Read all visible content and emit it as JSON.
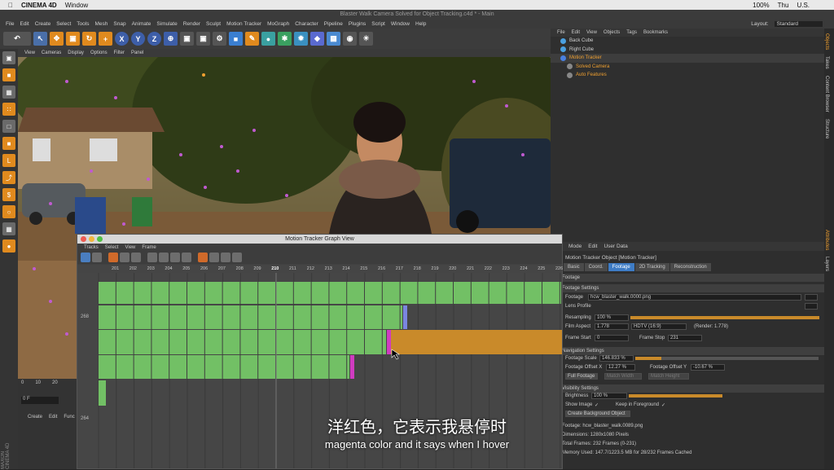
{
  "mac_menubar": {
    "app": "CINEMA 4D",
    "window": "Window",
    "status_right": "100%",
    "day": "Thu",
    "lang": "U.S."
  },
  "window_title": "Blaster Walk Camera Solved for Object Tracking.c4d * - Main",
  "main_menu": [
    "File",
    "Edit",
    "Create",
    "Select",
    "Tools",
    "Mesh",
    "Snap",
    "Animate",
    "Simulate",
    "Render",
    "Sculpt",
    "Motion Tracker",
    "MoGraph",
    "Character",
    "Pipeline",
    "Plugins",
    "Script",
    "Window",
    "Help"
  ],
  "layout": {
    "label": "Layout:",
    "value": "Standard"
  },
  "viewport_menu": [
    "View",
    "Cameras",
    "Display",
    "Options",
    "Filter",
    "Panel"
  ],
  "viewport_label": "Perspective",
  "object_manager": {
    "menu": [
      "File",
      "Edit",
      "View",
      "Objects",
      "Tags",
      "Bookmarks"
    ],
    "objects": [
      {
        "name": "Back Cube",
        "color": "#cfcfcf"
      },
      {
        "name": "Right Cube",
        "color": "#cfcfcf"
      },
      {
        "name": "Motion Tracker",
        "color": "#f0a030"
      },
      {
        "name": "Solved Camera",
        "color": "#f0a030"
      },
      {
        "name": "Auto Features",
        "color": "#f0a030"
      }
    ]
  },
  "right_tabs": [
    "Objects",
    "Takes",
    "Content Browser",
    "Structure"
  ],
  "right_tabs_bottom": [
    "Attributes",
    "Layers"
  ],
  "attributes": {
    "menu": [
      "Mode",
      "Edit",
      "User Data"
    ],
    "object_title": "Motion Tracker Object [Motion Tracker]",
    "tabs": [
      "Basic",
      "Coord.",
      "Footage",
      "2D Tracking",
      "Reconstruction"
    ],
    "active_tab": "Footage",
    "section_footage": "Footage",
    "sub_footage_settings": "Footage Settings",
    "footage_label": "Footage",
    "footage_value": "hcw_blaster_walk.0000.png",
    "lens_profile_label": "Lens Profile",
    "resampling_label": "Resampling",
    "resampling_value": "100 %",
    "film_aspect_label": "Film Aspect",
    "film_aspect_value": "1.778",
    "film_aspect_preset": "HDTV (16:9)",
    "render_aspect": "(Render: 1.778)",
    "frame_start_label": "Frame Start",
    "frame_start_value": "0",
    "frame_stop_label": "Frame Stop",
    "frame_stop_value": "231",
    "nav_settings": "Navigation Settings",
    "footage_scale_label": "Footage Scale",
    "footage_scale_value": "146.833 %",
    "offset_x_label": "Footage Offset X",
    "offset_x_value": "12.27 %",
    "offset_y_label": "Footage Offset Y",
    "offset_y_value": "-10.67 %",
    "full_footage": "Full Footage",
    "match_width": "Match Width",
    "match_height": "Match Height",
    "visibility_settings": "Visibility Settings",
    "brightness_label": "Brightness",
    "brightness_value": "100 %",
    "show_image_label": "Show Image",
    "keep_foreground_label": "Keep in Foreground",
    "create_bg": "Create Background Object",
    "info_footage": "Footage: hcw_blaster_walk.0089.png",
    "info_dimensions": "Dimensions: 1280x1080 Pixels",
    "info_frames": "Total Frames: 232 Frames (0-231)",
    "info_memory": "Memory Used: 147.7/1223.5 MB for 28/232 Frames Cached"
  },
  "graph_view": {
    "title": "Motion Tracker Graph View",
    "menu": [
      "Tracks",
      "Select",
      "View",
      "Frame"
    ],
    "frames": [
      "201",
      "202",
      "203",
      "204",
      "205",
      "206",
      "207",
      "208",
      "209",
      "210",
      "211",
      "212",
      "213",
      "214",
      "215",
      "216",
      "217",
      "218",
      "219",
      "220",
      "221",
      "222",
      "223",
      "224",
      "225",
      "226"
    ],
    "current_frame": "210",
    "track_labels": [
      "268",
      "264"
    ]
  },
  "timeline": {
    "ticks": [
      "0",
      "10",
      "20"
    ],
    "frame_field": "0 F",
    "menu": [
      "Create",
      "Edit",
      "Func"
    ]
  },
  "brand": "MAXON CINEMA 4D",
  "subtitle_zh": "洋红色，它表示我悬停时",
  "subtitle_en": "magenta color and it says when I hover",
  "colors": {
    "green": "#72c065",
    "orange": "#c98a2a",
    "magenta": "#d03cc0",
    "blue_marker": "#7a86e0"
  }
}
